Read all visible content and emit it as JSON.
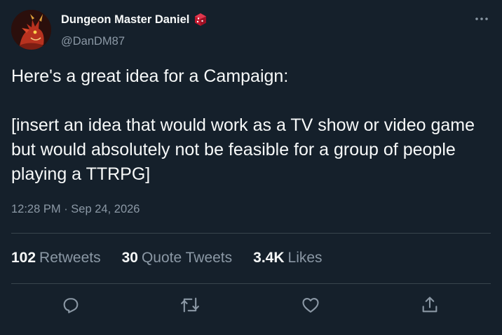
{
  "author": {
    "name": "Dungeon Master Daniel",
    "handle": "@DanDM87",
    "avatar_icon": "red-dragon-avatar",
    "badge_icon": "red-d20-dice-icon"
  },
  "tweet": {
    "paragraphs": [
      "Here's a great idea for a Campaign:",
      "[insert an idea that would work as a TV show or video game but would absolutely not be feasible for a group of people playing a TTRPG]"
    ]
  },
  "meta": {
    "time": "12:28 PM",
    "separator": " · ",
    "date": "Sep 24, 2026"
  },
  "stats": {
    "retweets": {
      "count": "102",
      "label": "Retweets"
    },
    "quotes": {
      "count": "30",
      "label": "Quote Tweets"
    },
    "likes": {
      "count": "3.4K",
      "label": "Likes"
    }
  },
  "actions": [
    "reply-icon",
    "retweet-icon",
    "like-icon",
    "share-icon"
  ],
  "colors": {
    "background": "#15202b",
    "text": "#f7f9f9",
    "secondary": "#8b98a5",
    "divider": "#38444d",
    "badge_red": "#c0172d"
  }
}
